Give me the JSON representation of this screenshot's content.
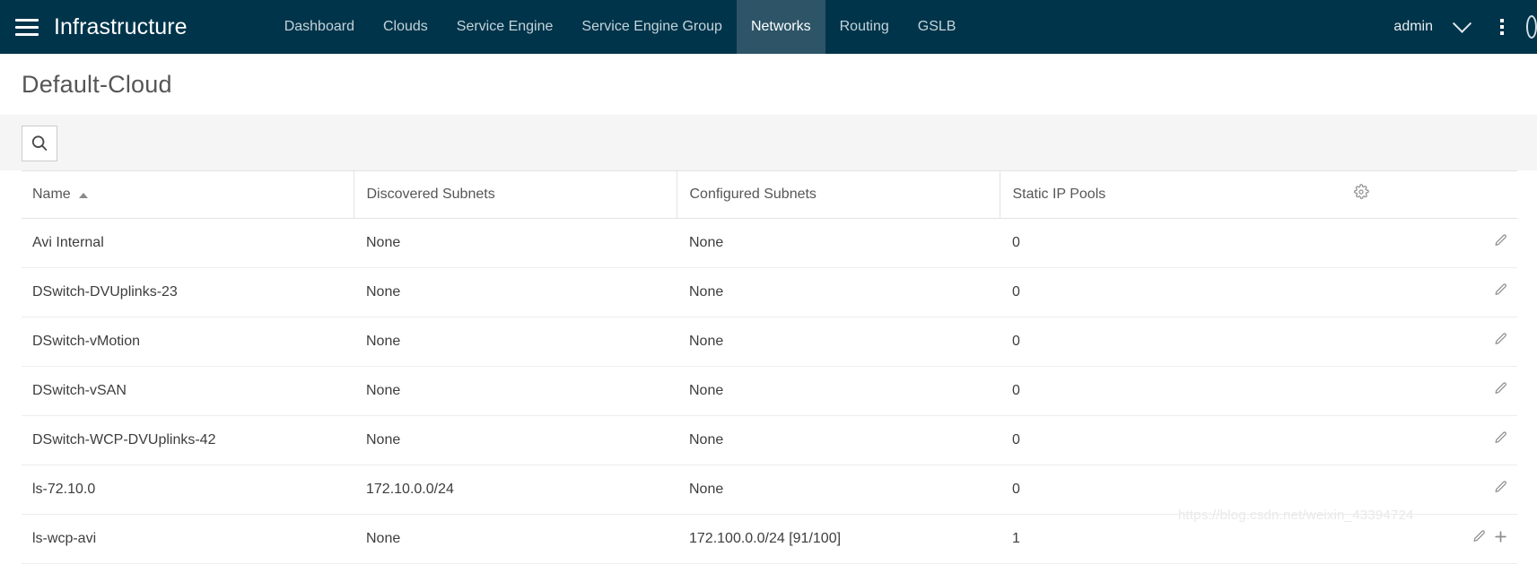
{
  "topbar": {
    "menu_icon": "hamburger-icon",
    "brand": "Infrastructure",
    "nav_items": [
      {
        "label": "Dashboard",
        "active": false
      },
      {
        "label": "Clouds",
        "active": false
      },
      {
        "label": "Service Engine",
        "active": false
      },
      {
        "label": "Service Engine Group",
        "active": false
      },
      {
        "label": "Networks",
        "active": true
      },
      {
        "label": "Routing",
        "active": false
      },
      {
        "label": "GSLB",
        "active": false
      }
    ],
    "user": "admin",
    "chevron_icon": "chevron-down-icon",
    "kebab_icon": "vertical-dots-icon",
    "edge_icon": "help-circle-icon",
    "bg_color": "#00344a",
    "active_tab_color": "#2d5467"
  },
  "page": {
    "title": "Default-Cloud",
    "title_color": "#565656",
    "toolbar_bg": "#f5f5f5"
  },
  "toolbar": {
    "search_icon": "search-icon",
    "search_label": "Search"
  },
  "table": {
    "settings_icon": "gear-icon",
    "sort": {
      "column": "Name",
      "direction": "asc",
      "icon": "sort-asc-caret-icon"
    },
    "columns": [
      "Name",
      "Discovered Subnets",
      "Configured Subnets",
      "Static IP Pools"
    ],
    "rows": [
      {
        "name": "Avi Internal",
        "discovered_subnets": "None",
        "configured_subnets": "None",
        "static_ip_pools": "0",
        "actions": [
          "edit-icon"
        ]
      },
      {
        "name": "DSwitch-DVUplinks-23",
        "discovered_subnets": "None",
        "configured_subnets": "None",
        "static_ip_pools": "0",
        "actions": [
          "edit-icon"
        ]
      },
      {
        "name": "DSwitch-vMotion",
        "discovered_subnets": "None",
        "configured_subnets": "None",
        "static_ip_pools": "0",
        "actions": [
          "edit-icon"
        ]
      },
      {
        "name": "DSwitch-vSAN",
        "discovered_subnets": "None",
        "configured_subnets": "None",
        "static_ip_pools": "0",
        "actions": [
          "edit-icon"
        ]
      },
      {
        "name": "DSwitch-WCP-DVUplinks-42",
        "discovered_subnets": "None",
        "configured_subnets": "None",
        "static_ip_pools": "0",
        "actions": [
          "edit-icon"
        ]
      },
      {
        "name": "ls-72.10.0",
        "discovered_subnets": "172.10.0.0/24",
        "configured_subnets": "None",
        "static_ip_pools": "0",
        "actions": [
          "edit-icon"
        ]
      },
      {
        "name": "ls-wcp-avi",
        "discovered_subnets": "None",
        "configured_subnets": "172.100.0.0/24 [91/100]",
        "static_ip_pools": "1",
        "actions": [
          "edit-icon",
          "add-icon"
        ]
      }
    ]
  },
  "watermark": {
    "text": "https://blog.csdn.net/weixin_43394724"
  }
}
